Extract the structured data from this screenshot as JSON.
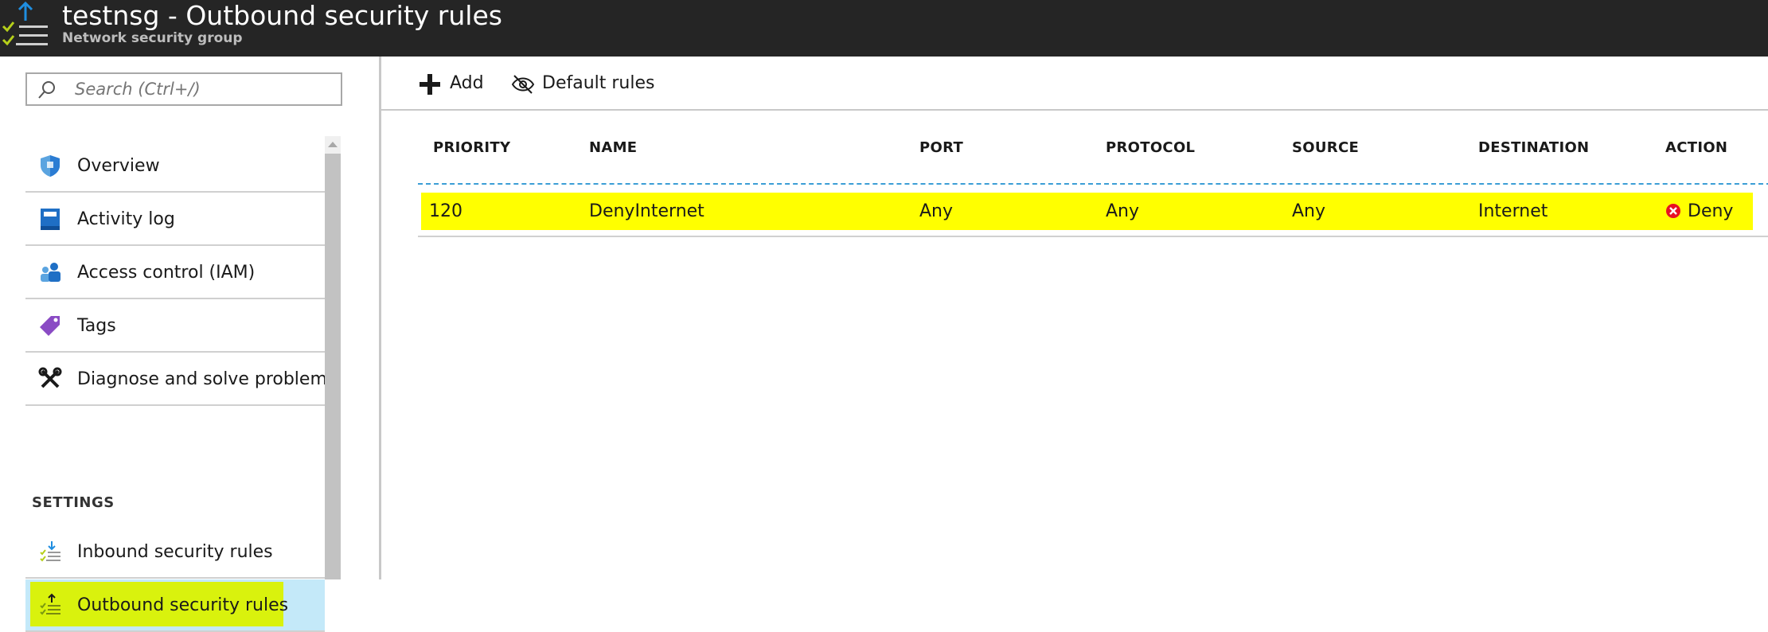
{
  "header": {
    "title": "testnsg - Outbound security rules",
    "subtitle": "Network security group",
    "icon": "nsg-outbound-icon"
  },
  "sidebar": {
    "search": {
      "placeholder": "Search (Ctrl+/)",
      "value": ""
    },
    "items": [
      {
        "label": "Overview",
        "icon": "shield-icon"
      },
      {
        "label": "Activity log",
        "icon": "activity-log-icon"
      },
      {
        "label": "Access control (IAM)",
        "icon": "iam-users-icon"
      },
      {
        "label": "Tags",
        "icon": "tag-icon"
      },
      {
        "label": "Diagnose and solve problems",
        "icon": "wrench-icon"
      }
    ],
    "section_settings": "SETTINGS",
    "settings_items": [
      {
        "label": "Inbound security rules",
        "icon": "inbound-rules-icon"
      },
      {
        "label": "Outbound security rules",
        "icon": "outbound-rules-icon",
        "selected": true
      }
    ]
  },
  "toolbar": {
    "add_label": "Add",
    "default_rules_label": "Default rules"
  },
  "table": {
    "columns": [
      "PRIORITY",
      "NAME",
      "PORT",
      "PROTOCOL",
      "SOURCE",
      "DESTINATION",
      "ACTION"
    ],
    "rows": [
      {
        "priority": "120",
        "name": "DenyInternet",
        "port": "Any",
        "protocol": "Any",
        "source": "Any",
        "destination": "Internet",
        "action": "Deny",
        "action_icon": "deny-icon"
      }
    ]
  },
  "colors": {
    "header_bg": "#252525",
    "selected_bg": "#c4e9f9",
    "highlight_green": "#d9f20d",
    "row_highlight": "#ffff00",
    "accent_blue": "#0078d4",
    "deny_red": "#e81123"
  }
}
